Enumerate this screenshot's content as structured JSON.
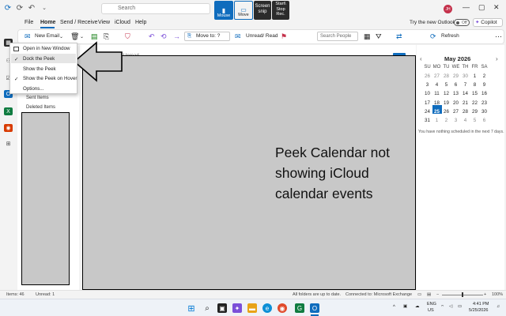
{
  "titlebar": {
    "search_placeholder": "Search",
    "snip_buttons": [
      {
        "label": "Mouse",
        "bg": "#0f6cbd"
      },
      {
        "label": "Move",
        "bg": "#f3f3f3"
      },
      {
        "label": "Screen snip",
        "bg": "#2b2b2b"
      },
      {
        "label": "Start\\ Stop Rec.",
        "bg": "#2b2b2b"
      }
    ],
    "avatar_initials": "JH"
  },
  "menu": {
    "tabs": [
      "File",
      "Home",
      "Send / Receive",
      "View",
      "iCloud",
      "Help"
    ],
    "new_outlook_label": "Try the new Outlook",
    "toggle_label": "Off",
    "copilot_label": "Copilot"
  },
  "ribbon": {
    "new_email": "New Email",
    "move_to": "Move to: ?",
    "unread_read": "Unread/ Read",
    "search_people": "Search People",
    "refresh": "Refresh"
  },
  "context_menu": {
    "items": [
      {
        "label": "Open in New Window",
        "checked": false
      },
      {
        "label": "Dock the Peek",
        "checked": true
      },
      {
        "label": "Show the Peek",
        "checked": false
      },
      {
        "label": "Show the Peek on Hover",
        "checked": true
      },
      {
        "label": "Options...",
        "checked": false
      }
    ]
  },
  "folders": {
    "sent": "Sent Items",
    "deleted": "Deleted Items"
  },
  "message_list": {
    "header_partial": "Unread"
  },
  "annotation": {
    "note": "Peek Calendar not showing iCloud calendar events"
  },
  "calendar": {
    "title": "May 2026",
    "weekdays": [
      "SU",
      "MO",
      "TU",
      "WE",
      "TH",
      "FR",
      "SA"
    ],
    "weeks": [
      [
        "26",
        "27",
        "28",
        "29",
        "30",
        "1",
        "2"
      ],
      [
        "3",
        "4",
        "5",
        "6",
        "7",
        "8",
        "9"
      ],
      [
        "10",
        "11",
        "12",
        "13",
        "14",
        "15",
        "16"
      ],
      [
        "17",
        "18",
        "19",
        "20",
        "21",
        "22",
        "23"
      ],
      [
        "24",
        "25",
        "26",
        "27",
        "28",
        "29",
        "30"
      ],
      [
        "31",
        "1",
        "2",
        "3",
        "4",
        "5",
        "6"
      ]
    ],
    "today": "25",
    "nothing_scheduled": "You have nothing scheduled in the next 7 days."
  },
  "status": {
    "items": "Items: 46",
    "unread": "Unread: 1",
    "all_folders": "All folders are up to date.",
    "connected": "Connected to: Microsoft Exchange",
    "zoom": "100%"
  },
  "taskbar": {
    "lang": "ENG",
    "region": "US",
    "time": "4:41 PM",
    "date": "5/25/2026"
  }
}
